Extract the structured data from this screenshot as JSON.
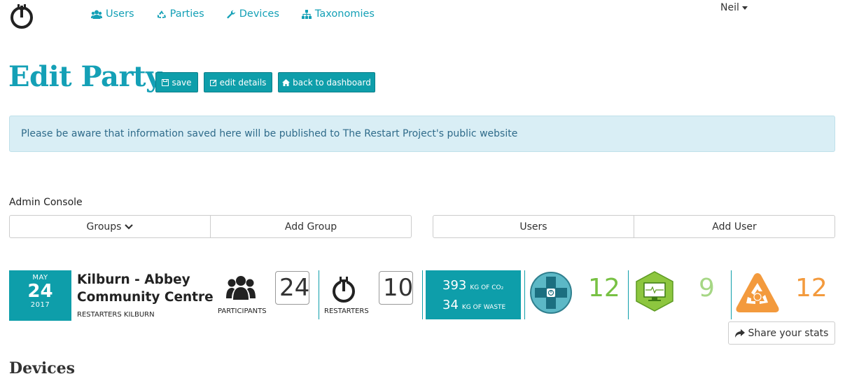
{
  "nav": {
    "items": [
      {
        "label": "Users",
        "icon": "users-icon"
      },
      {
        "label": "Parties",
        "icon": "recycle-icon"
      },
      {
        "label": "Devices",
        "icon": "wrench-icon"
      },
      {
        "label": "Taxonomies",
        "icon": "sitemap-icon"
      }
    ],
    "user": "Neil"
  },
  "header": {
    "title": "Edit Party",
    "buttons": {
      "save": "save",
      "edit_details": "edit details",
      "back": "back to dashboard"
    }
  },
  "alert": {
    "text": "Please be aware that information saved here will be published to The Restart Project's public website"
  },
  "admin": {
    "label": "Admin Console",
    "groups": "Groups",
    "add_group": "Add Group",
    "users": "Users",
    "add_user": "Add User"
  },
  "party": {
    "month": "MAY",
    "day": "24",
    "year": "2017",
    "name": "Kilburn - Abbey Community Centre",
    "group": "RESTARTERS KILBURN",
    "participants_label": "PARTICIPANTS",
    "participants": "24",
    "restarters_label": "RESTARTERS",
    "restarters": "10",
    "co2_value": "393",
    "co2_unit": "KG OF CO₂",
    "waste_value": "34",
    "waste_unit": "KG OF WASTE",
    "fixed": "12",
    "repairable": "9",
    "dead": "12",
    "share_label": "Share your stats"
  },
  "colors": {
    "accent": "#0e9eaa",
    "link": "#14a0b6",
    "fixed": "#78c144",
    "repairable": "#a6d785",
    "dead": "#f39a3d"
  },
  "devices": {
    "title": "Devices"
  }
}
